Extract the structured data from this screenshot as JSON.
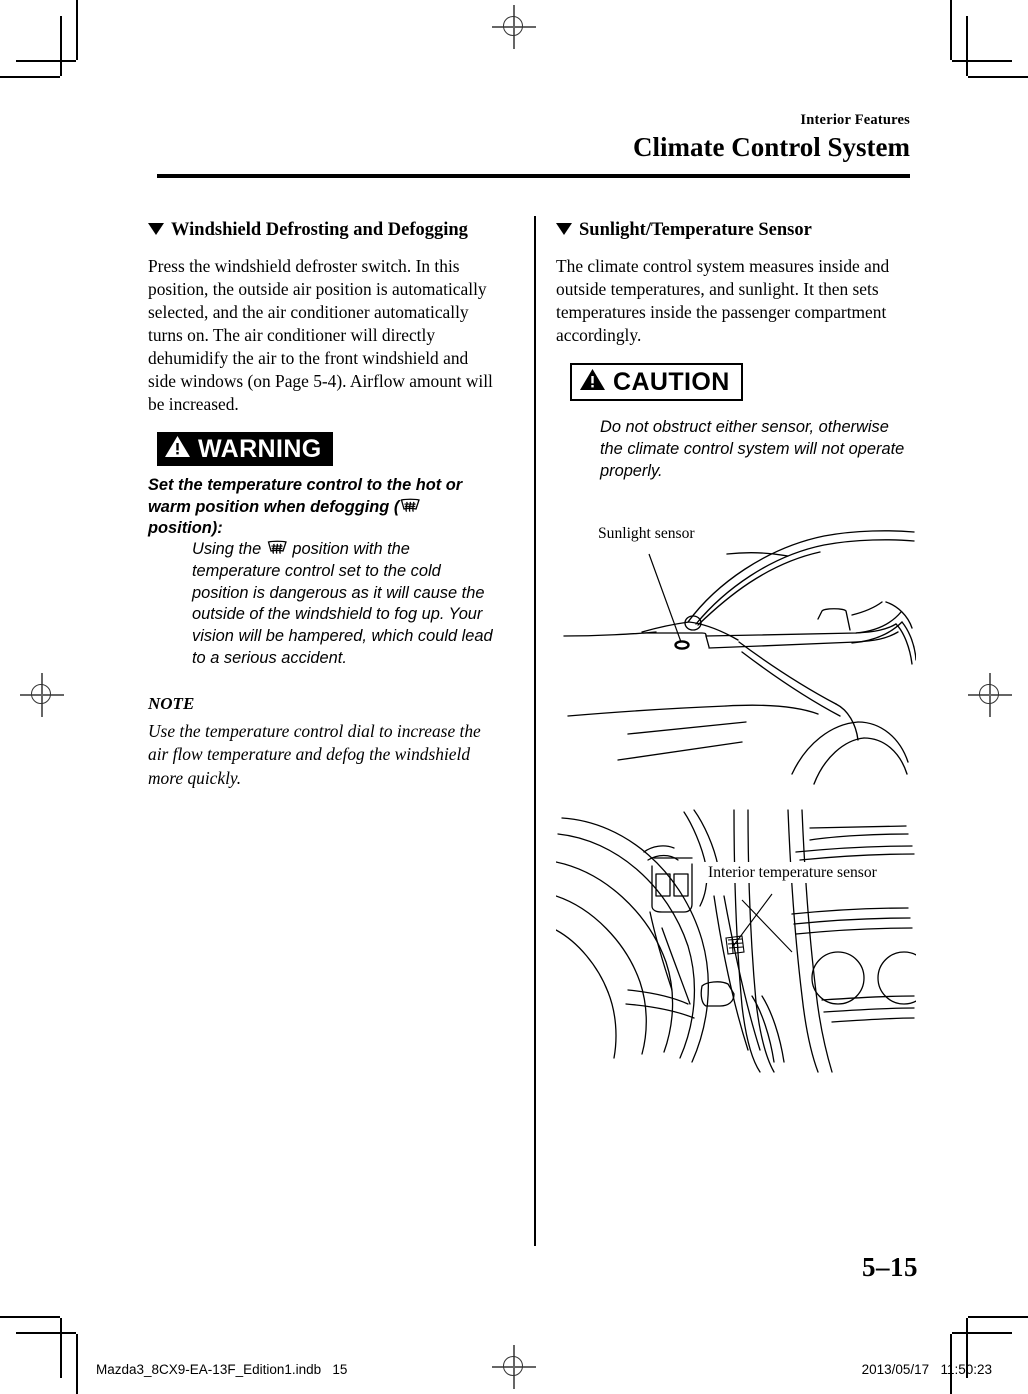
{
  "header": {
    "kicker": "Interior Features",
    "title": "Climate Control System"
  },
  "left_column": {
    "section_heading": "Windshield Defrosting and Defogging",
    "paragraph": "Press the windshield defroster switch. In this position, the outside air position is automatically selected, and the air conditioner automatically turns on. The air conditioner will directly dehumidify the air to the front windshield and side windows (on Page 5-4). Airflow amount will be increased.",
    "warning": {
      "badge_label": "WARNING",
      "lead_before_icon": "Set the temperature control to the hot or warm position when defogging (",
      "lead_after_icon": " position):",
      "body_before_icon": "Using the",
      "body_after_icon": "position with the temperature control set to the cold position is dangerous as it will cause the outside of the windshield to fog up. Your vision will be hampered, which could lead to a serious accident."
    },
    "note": {
      "heading": "NOTE",
      "body": "Use the temperature control dial to increase the air flow temperature and defog the windshield more quickly."
    }
  },
  "right_column": {
    "section_heading": "Sunlight/Temperature Sensor",
    "paragraph": "The climate control system measures inside and outside temperatures, and sunlight. It then sets temperatures inside the passenger compartment accordingly.",
    "caution": {
      "badge_label": "CAUTION",
      "body": "Do not obstruct either sensor, otherwise the climate control system will not operate properly."
    },
    "figures": [
      {
        "caption": "Sunlight sensor"
      },
      {
        "caption": "Interior temperature sensor"
      }
    ]
  },
  "page_number": "5–15",
  "footer": {
    "left": "Mazda3_8CX9-EA-13F_Edition1.indb   15",
    "right": "2013/05/17   11:50:23"
  },
  "colors": {
    "ink": "#000000",
    "paper": "#ffffff",
    "mark": "#666666"
  }
}
